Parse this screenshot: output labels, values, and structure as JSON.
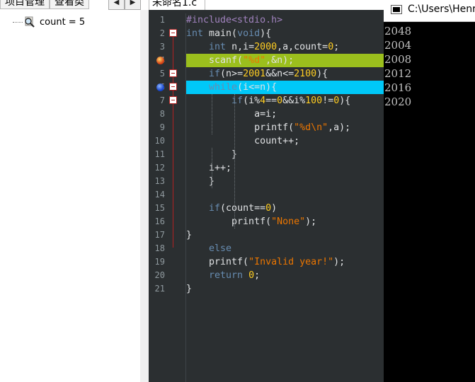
{
  "left_panel": {
    "tabs": [
      "项目管理",
      "查看类"
    ],
    "watch_item": "count = 5"
  },
  "nav": {
    "prev": "◀",
    "next": "▶"
  },
  "editor": {
    "file_tab": "未命名1.c",
    "line_numbers": [
      "1",
      "2",
      "3",
      "4",
      "5",
      "6",
      "7",
      "8",
      "9",
      "10",
      "11",
      "12",
      "13",
      "14",
      "15",
      "16",
      "17",
      "18",
      "19",
      "20",
      "21"
    ],
    "lines": [
      "#include<stdio.h>",
      "int main(void){",
      "    int n,i=2000,a,count=0;",
      "    scanf(\"%d\",&n);",
      "    if(n>=2001&&n<=2100){",
      "    while(i<=n){",
      "        if(i%4==0&&i%100!=0){",
      "            a=i;",
      "            printf(\"%d\\n\",a);",
      "            count++;",
      "        }",
      "    i++;",
      "    }",
      "",
      "    if(count==0)",
      "        printf(\"None\");",
      "}",
      "    else",
      "    printf(\"Invalid year!\");",
      "    return 0;",
      "}"
    ]
  },
  "console": {
    "title": "C:\\Users\\Henry",
    "output": [
      "2048",
      "2004",
      "2008",
      "2012",
      "2016",
      "2020"
    ]
  },
  "colors": {
    "editor_bg": "#2b2f31",
    "breakpoint_line": "#9bbf1d",
    "current_line": "#00c8f8",
    "keyword": "#93c763",
    "number": "#ffcd22",
    "string": "#ec7600"
  }
}
